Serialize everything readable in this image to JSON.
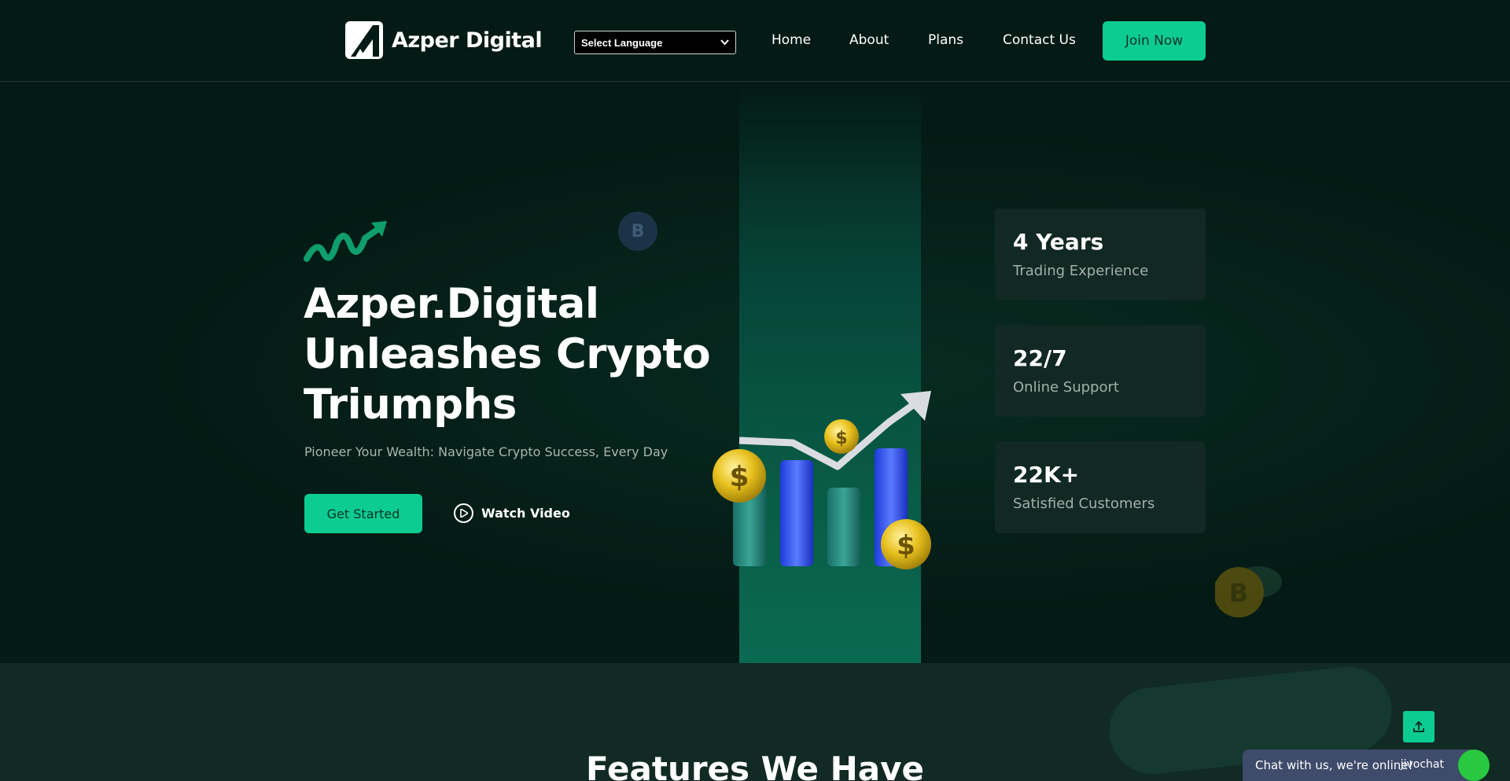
{
  "header": {
    "brand": "Azper Digital",
    "language_select": "Select Language",
    "nav": [
      "Home",
      "About",
      "Plans",
      "Contact Us"
    ],
    "join_label": "Join Now"
  },
  "hero": {
    "title": "Azper.Digital Unleashes Crypto Triumphs",
    "subtitle": "Pioneer Your Wealth: Navigate Crypto Success, Every Day",
    "get_started": "Get Started",
    "watch_video": "Watch Video",
    "btc_symbol": "B",
    "stats": [
      {
        "value": "4 Years",
        "label": "Trading Experience"
      },
      {
        "value": "22/7",
        "label": "Online Support"
      },
      {
        "value": "22K+",
        "label": "Satisfied Customers"
      }
    ]
  },
  "features": {
    "title": "Features We Have"
  },
  "chat": {
    "message": "Chat with us, we're online!",
    "brand": "jivochat"
  },
  "colors": {
    "accent": "#0ccc91",
    "background": "#041a14",
    "card": "#122823"
  }
}
